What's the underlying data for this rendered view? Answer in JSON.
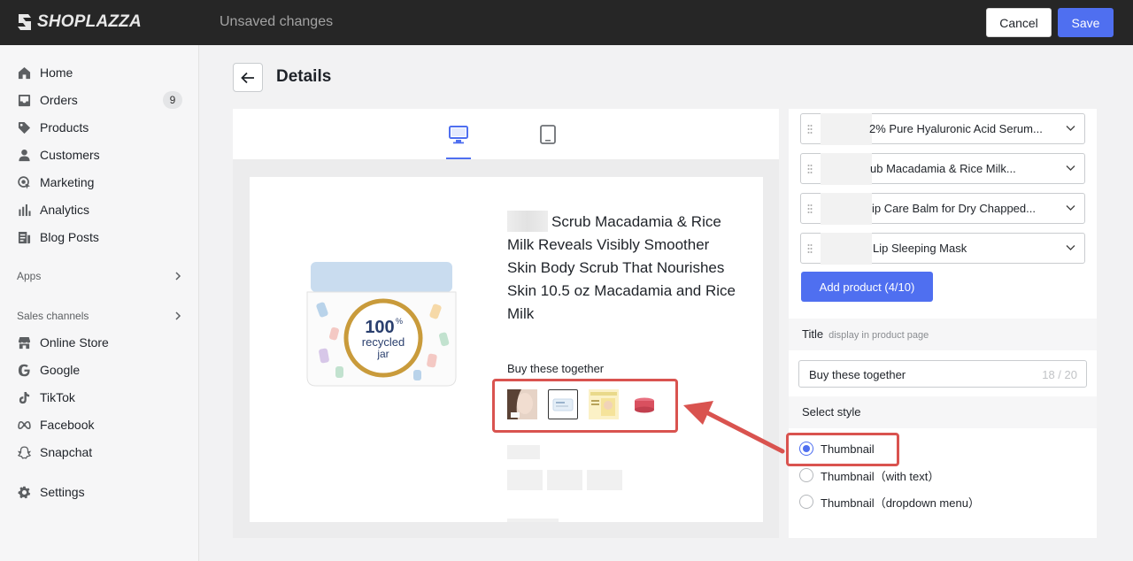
{
  "topbar": {
    "logo_text": "SHOPLAZZA",
    "status": "Unsaved changes",
    "cancel_label": "Cancel",
    "save_label": "Save"
  },
  "sidebar": {
    "items": [
      {
        "label": "Home",
        "icon": "home-icon"
      },
      {
        "label": "Orders",
        "icon": "inbox-icon",
        "badge": "9"
      },
      {
        "label": "Products",
        "icon": "tag-icon"
      },
      {
        "label": "Customers",
        "icon": "person-icon"
      },
      {
        "label": "Marketing",
        "icon": "target-icon"
      },
      {
        "label": "Analytics",
        "icon": "bar-chart-icon"
      },
      {
        "label": "Blog Posts",
        "icon": "blog-icon"
      }
    ],
    "apps_label": "Apps",
    "channels_label": "Sales channels",
    "channels": [
      {
        "label": "Online Store",
        "icon": "store-icon"
      },
      {
        "label": "Google",
        "icon": "google-icon"
      },
      {
        "label": "TikTok",
        "icon": "tiktok-icon"
      },
      {
        "label": "Facebook",
        "icon": "meta-icon"
      },
      {
        "label": "Snapchat",
        "icon": "ghost-icon"
      }
    ],
    "settings_label": "Settings"
  },
  "page": {
    "title": "Details"
  },
  "preview": {
    "jar_text_main": "100",
    "jar_text_pct": "%",
    "jar_text_line2": "recycled",
    "jar_text_line3": "jar",
    "product_title": "Scrub Macadamia & Rice Milk Reveals Visibly Smoother Skin Body Scrub That Nourishes Skin 10.5 oz Macadamia and Rice Milk",
    "bundle_title": "Buy these together"
  },
  "settings": {
    "products": [
      {
        "name": "2% Pure Hyaluronic Acid Serum..."
      },
      {
        "name": "ub Macadamia & Rice Milk..."
      },
      {
        "name": "ip Care Balm for Dry Chapped..."
      },
      {
        "name": "Lip Sleeping Mask"
      }
    ],
    "add_button": "Add product (4/10)",
    "title_label": "Title",
    "title_hint": "display in product page",
    "title_value": "Buy these together",
    "title_count": "18 / 20",
    "style_label": "Select style",
    "styles": [
      {
        "label": "Thumbnail",
        "checked": true
      },
      {
        "label": "Thumbnail（with text）",
        "checked": false
      },
      {
        "label": "Thumbnail（dropdown menu）",
        "checked": false
      }
    ]
  },
  "colors": {
    "accent": "#4f6ff0",
    "highlight": "#d9534f",
    "topbar": "#262626"
  }
}
